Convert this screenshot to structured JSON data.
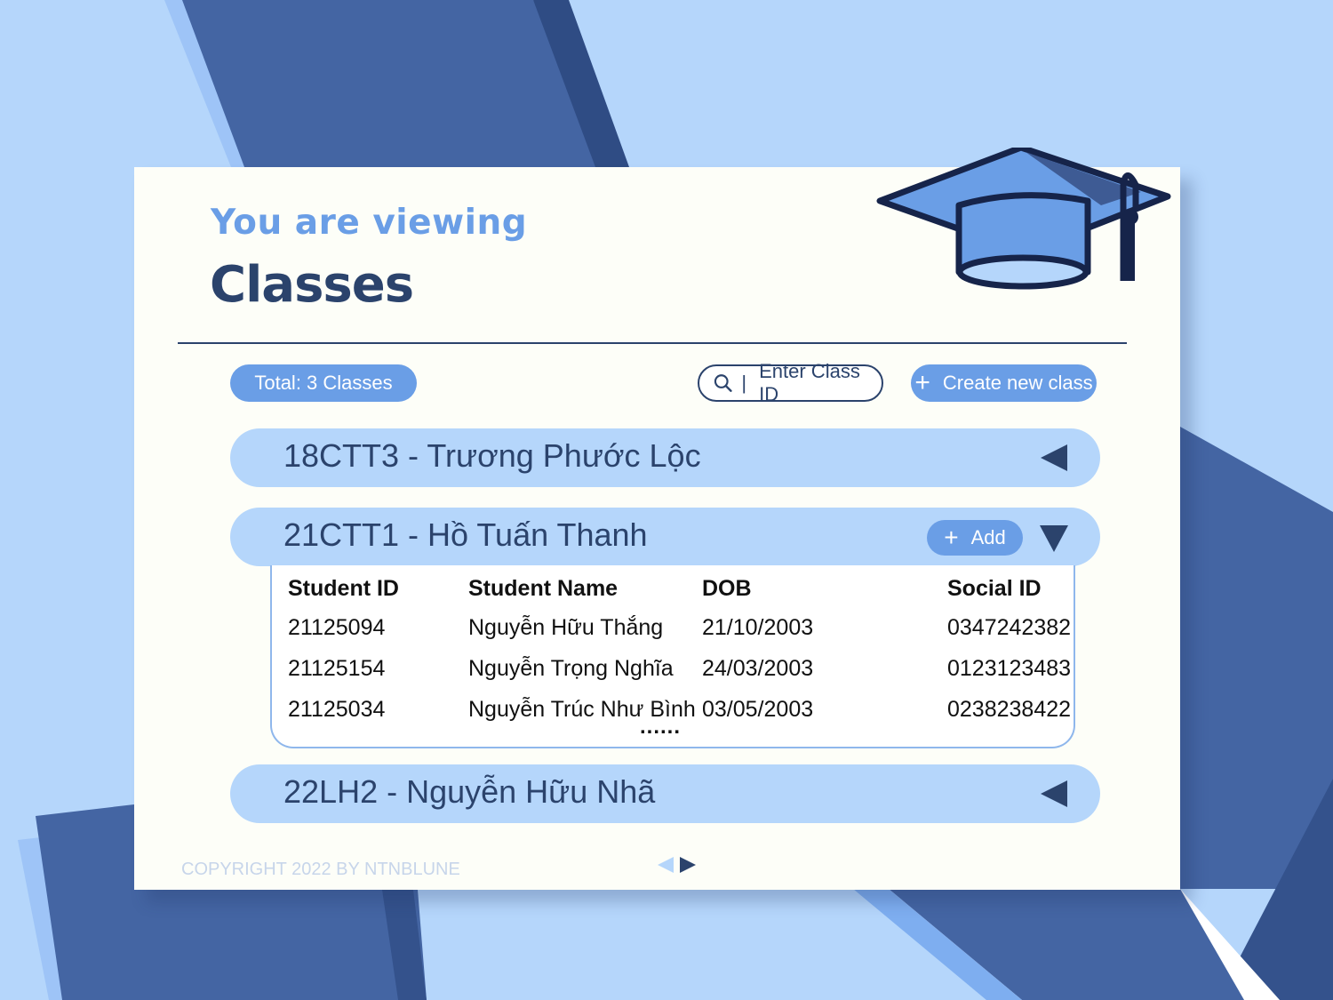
{
  "header": {
    "subtitle": "You are viewing",
    "title": "Classes"
  },
  "toolbar": {
    "total_label": "Total: 3 Classes",
    "search_placeholder": "Enter Class ID",
    "create_label": "Create new class"
  },
  "classes": [
    {
      "label": "18CTT3 - Trương Phước Lộc",
      "expanded": false
    },
    {
      "label": "21CTT1 - Hồ Tuấn Thanh",
      "expanded": true,
      "add_label": "Add"
    },
    {
      "label": "22LH2 - Nguyễn Hữu Nhã",
      "expanded": false
    }
  ],
  "student_table": {
    "columns": [
      "Student ID",
      "Student Name",
      "DOB",
      "Social ID"
    ],
    "rows": [
      [
        "21125094",
        "Nguyễn Hữu Thắng",
        "21/10/2003",
        "0347242382"
      ],
      [
        "21125154",
        "Nguyễn Trọng Nghĩa",
        "24/03/2003",
        "0123123483"
      ],
      [
        "21125034",
        "Nguyễn Trúc Như Bình",
        "03/05/2003",
        "0238238422"
      ]
    ],
    "more_indicator": "......"
  },
  "footer": {
    "copyright": "COPYRIGHT 2022 BY NTNBLUNE"
  },
  "colors": {
    "background": "#b5d6fb",
    "card": "#fdfef8",
    "navy": "#2b436c",
    "accent": "#6a9ee6",
    "row": "#b5d6fb"
  },
  "icons": {
    "search": "search-icon",
    "plus": "plus-icon",
    "collapsed": "caret-left-icon",
    "expanded": "caret-down-icon",
    "logo": "graduation-cap-icon"
  }
}
